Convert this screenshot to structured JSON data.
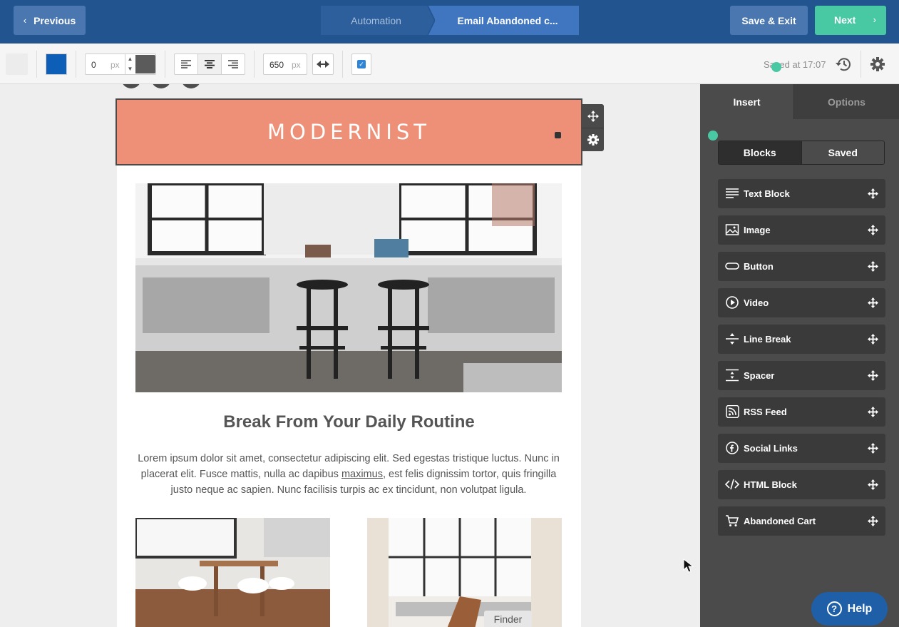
{
  "topbar": {
    "previous_label": "Previous",
    "breadcrumbs": [
      "Automation",
      "Email Abandoned c..."
    ],
    "save_exit_label": "Save & Exit",
    "next_label": "Next"
  },
  "toolbar": {
    "background_color": "#0d5eb6",
    "border_width": "0",
    "border_unit": "px",
    "border_color": "#5b5b5b",
    "content_width": "650",
    "width_unit": "px",
    "saved_status": "Saved at 17:07"
  },
  "email": {
    "logo_text": "MODERNIST",
    "header_bg": "#ed9077",
    "headline": "Break From Your Daily Routine",
    "body_before_link": "Lorem ipsum dolor sit amet, consectetur adipiscing elit. Sed egestas tristique luctus. Nunc in placerat elit. Fusce mattis, nulla ac dapibus ",
    "body_link": "maximus",
    "body_after_link": ", est felis dignissim tortor, quis fringilla justo neque ac sapien. Nunc facilisis turpis ac ex tincidunt, non volutpat ligula."
  },
  "tooltip": "Finder",
  "sidebar": {
    "tabs": [
      "Insert",
      "Options"
    ],
    "segments": [
      "Blocks",
      "Saved"
    ],
    "blocks": [
      {
        "label": "Text Block",
        "icon": "text-lines-icon"
      },
      {
        "label": "Image",
        "icon": "image-icon"
      },
      {
        "label": "Button",
        "icon": "button-icon"
      },
      {
        "label": "Video",
        "icon": "play-icon"
      },
      {
        "label": "Line Break",
        "icon": "line-break-icon"
      },
      {
        "label": "Spacer",
        "icon": "spacer-icon"
      },
      {
        "label": "RSS Feed",
        "icon": "rss-icon"
      },
      {
        "label": "Social Links",
        "icon": "facebook-icon"
      },
      {
        "label": "HTML Block",
        "icon": "code-icon"
      },
      {
        "label": "Abandoned Cart",
        "icon": "cart-icon"
      }
    ]
  },
  "help_label": "Help",
  "colors": {
    "topbar": "#22558f",
    "accent_green": "#48c9a4",
    "sidebar": "#4b4b4b"
  }
}
